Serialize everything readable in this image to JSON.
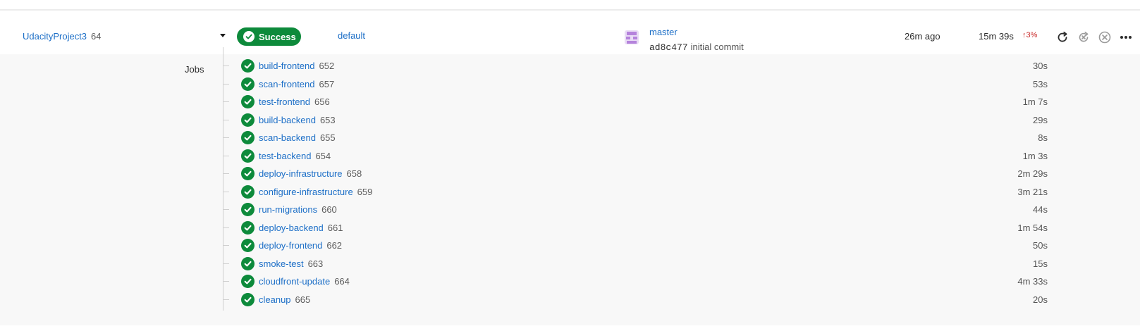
{
  "pipeline": {
    "project_name": "UdacityProject3",
    "pipeline_number": "64",
    "status": "Success",
    "workflow": "default",
    "branch": "master",
    "commit_sha": "ad8c477",
    "commit_message": "initial commit",
    "time_ago": "26m ago",
    "duration": "15m 39s",
    "trend_arrow": "↑",
    "trend_percent": "3%",
    "status_color": "#0d8a3b",
    "trend_color": "#c92a2a"
  },
  "jobs_panel": {
    "title": "Jobs",
    "jobs": [
      {
        "name": "build-frontend",
        "number": "652",
        "duration": "30s"
      },
      {
        "name": "scan-frontend",
        "number": "657",
        "duration": "53s"
      },
      {
        "name": "test-frontend",
        "number": "656",
        "duration": "1m 7s"
      },
      {
        "name": "build-backend",
        "number": "653",
        "duration": "29s"
      },
      {
        "name": "scan-backend",
        "number": "655",
        "duration": "8s"
      },
      {
        "name": "test-backend",
        "number": "654",
        "duration": "1m 3s"
      },
      {
        "name": "deploy-infrastructure",
        "number": "658",
        "duration": "2m 29s"
      },
      {
        "name": "configure-infrastructure",
        "number": "659",
        "duration": "3m 21s"
      },
      {
        "name": "run-migrations",
        "number": "660",
        "duration": "44s"
      },
      {
        "name": "deploy-backend",
        "number": "661",
        "duration": "1m 54s"
      },
      {
        "name": "deploy-frontend",
        "number": "662",
        "duration": "50s"
      },
      {
        "name": "smoke-test",
        "number": "663",
        "duration": "15s"
      },
      {
        "name": "cloudfront-update",
        "number": "664",
        "duration": "4m 33s"
      },
      {
        "name": "cleanup",
        "number": "665",
        "duration": "20s"
      }
    ]
  },
  "icons": {
    "expand": "chevron-down-icon",
    "status": "check-icon",
    "avatar": "avatar-icon",
    "rerun": "rerun-icon",
    "rerun_failed": "rerun-from-failed-icon",
    "cancel": "cancel-icon",
    "more": "more-icon"
  }
}
